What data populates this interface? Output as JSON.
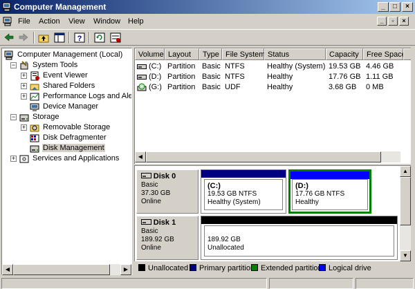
{
  "window": {
    "title": "Computer Management",
    "buttons": {
      "minimize": "_",
      "maximize": "□",
      "close": "×"
    }
  },
  "menu": {
    "items": [
      {
        "label": "File"
      },
      {
        "label": "Action"
      },
      {
        "label": "View"
      },
      {
        "label": "Window"
      },
      {
        "label": "Help"
      }
    ],
    "mdi_buttons": {
      "minimize": "_",
      "restore": "▫",
      "close": "×"
    }
  },
  "toolbar": {
    "icons": [
      "back-arrow-icon",
      "forward-arrow-icon",
      "up-folder-icon",
      "show-hide-tree-icon",
      "help-icon",
      "refresh-icon",
      "properties-icon"
    ]
  },
  "tree": {
    "items": [
      {
        "label": "Computer Management (Local)",
        "icon": "computer-management-icon",
        "expander": "",
        "level": 0
      },
      {
        "label": "System Tools",
        "icon": "system-tools-icon",
        "expander": "−",
        "level": 1
      },
      {
        "label": "Event Viewer",
        "icon": "event-viewer-icon",
        "expander": "+",
        "level": 2
      },
      {
        "label": "Shared Folders",
        "icon": "shared-folders-icon",
        "expander": "+",
        "level": 2
      },
      {
        "label": "Performance Logs and Alerts",
        "icon": "performance-logs-icon",
        "expander": "+",
        "level": 2
      },
      {
        "label": "Device Manager",
        "icon": "device-manager-icon",
        "expander": "",
        "level": 2
      },
      {
        "label": "Storage",
        "icon": "storage-icon",
        "expander": "−",
        "level": 1
      },
      {
        "label": "Removable Storage",
        "icon": "removable-storage-icon",
        "expander": "+",
        "level": 2
      },
      {
        "label": "Disk Defragmenter",
        "icon": "disk-defragmenter-icon",
        "expander": "",
        "level": 2
      },
      {
        "label": "Disk Management",
        "icon": "disk-management-icon",
        "expander": "",
        "level": 2,
        "selected": true
      },
      {
        "label": "Services and Applications",
        "icon": "services-applications-icon",
        "expander": "+",
        "level": 1
      }
    ]
  },
  "volume_list": {
    "columns": [
      "Volume",
      "Layout",
      "Type",
      "File System",
      "Status",
      "Capacity",
      "Free Space"
    ],
    "rows": [
      {
        "volume": "(C:)",
        "layout": "Partition",
        "type": "Basic",
        "fs": "NTFS",
        "status": "Healthy (System)",
        "capacity": "19.53 GB",
        "free": "4.46 GB",
        "icon": "hard-drive-icon"
      },
      {
        "volume": "(D:)",
        "layout": "Partition",
        "type": "Basic",
        "fs": "NTFS",
        "status": "Healthy",
        "capacity": "17.76 GB",
        "free": "1.11 GB",
        "icon": "hard-drive-icon"
      },
      {
        "volume": "(G:)",
        "layout": "Partition",
        "type": "Basic",
        "fs": "UDF",
        "status": "Healthy",
        "capacity": "3.68 GB",
        "free": "0 MB",
        "icon": "cd-drive-icon"
      }
    ]
  },
  "disks": [
    {
      "name": "Disk 0",
      "type": "Basic",
      "size": "37.30 GB",
      "state": "Online",
      "partitions": [
        {
          "name": "(C:)",
          "size": "19.53 GB NTFS",
          "status": "Healthy (System)",
          "kind": "primary"
        },
        {
          "name": "(D:)",
          "size": "17.76 GB NTFS",
          "status": "Healthy",
          "kind": "logical",
          "selected": true
        }
      ]
    },
    {
      "name": "Disk 1",
      "type": "Basic",
      "size": "189.92 GB",
      "state": "Online",
      "partitions": [
        {
          "name": "",
          "size": "189.92 GB",
          "status": "Unallocated",
          "kind": "unallocated"
        }
      ]
    }
  ],
  "legend": [
    {
      "label": "Unallocated",
      "color": "#000000"
    },
    {
      "label": "Primary partition",
      "color": "#000080"
    },
    {
      "label": "Extended partition",
      "color": "#008000"
    },
    {
      "label": "Logical drive",
      "color": "#0000ff"
    }
  ],
  "colors": {
    "title_gradient_start": "#0a246a",
    "title_gradient_end": "#a6caf0",
    "primary": "#000080",
    "logical": "#0000ff",
    "extended": "#008000",
    "unallocated": "#000000"
  }
}
